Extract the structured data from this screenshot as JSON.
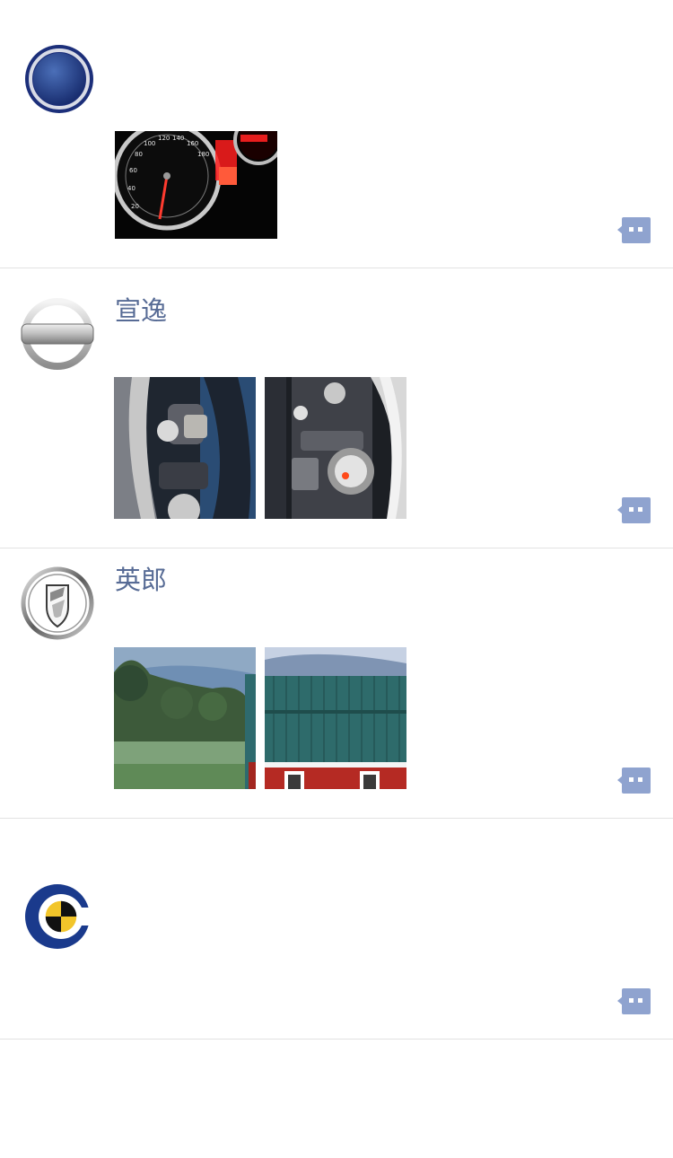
{
  "feed": {
    "posts": [
      {
        "name": "",
        "avatar_icon": "round-blue-logo-icon",
        "images": [
          "speedometer-photo"
        ]
      },
      {
        "name": "宣逸",
        "avatar_icon": "nissan-logo-icon",
        "images": [
          "steering-wheel-photo-left",
          "dashboard-controls-photo-right"
        ]
      },
      {
        "name": "英郎",
        "avatar_icon": "buick-logo-icon",
        "images": [
          "farm-field-photo-left",
          "red-barn-photo-right"
        ]
      },
      {
        "name": "",
        "avatar_icon": "crash-test-logo-icon",
        "images": []
      }
    ],
    "comment_icon": "comment-bubble-icon",
    "colors": {
      "name": "#576b95",
      "comment_button": "#8fa3cf",
      "divider": "#e2e2e2"
    }
  }
}
